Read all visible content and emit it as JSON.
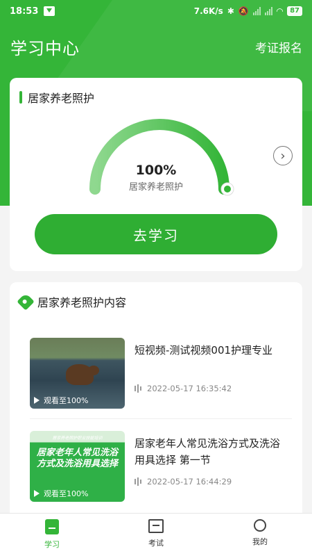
{
  "status_bar": {
    "time": "18:53",
    "network_speed": "7.6K/s",
    "battery": "87"
  },
  "header": {
    "title": "学习中心",
    "action_label": "考证报名"
  },
  "progress_card": {
    "heading": "居家养老照护",
    "percent_text": "100%",
    "progress": 1.0,
    "gauge_label": "居家养老照护",
    "button_label": "去学习"
  },
  "content_card": {
    "heading": "居家养老照护内容",
    "items": [
      {
        "title": "短视频-测试视频001护理专业",
        "date": "2022-05-17 16:35:42",
        "watched": "观看至100%"
      },
      {
        "title": "居家老年人常见洗浴方式及洗浴用具选择 第一节",
        "date": "2022-05-17 16:44:29",
        "watched": "观看至100%",
        "thumb_small": "居家养老照护职业技能培训",
        "thumb_title": "居家老年人常见洗浴方式及洗浴用具选择"
      }
    ]
  },
  "bottom_nav": {
    "items": [
      {
        "label": "学习",
        "icon": "book-icon"
      },
      {
        "label": "考试",
        "icon": "exam-icon"
      },
      {
        "label": "我的",
        "icon": "user-icon"
      }
    ]
  },
  "colors": {
    "primary": "#34b538",
    "gauge_light": "#8fd88f"
  }
}
